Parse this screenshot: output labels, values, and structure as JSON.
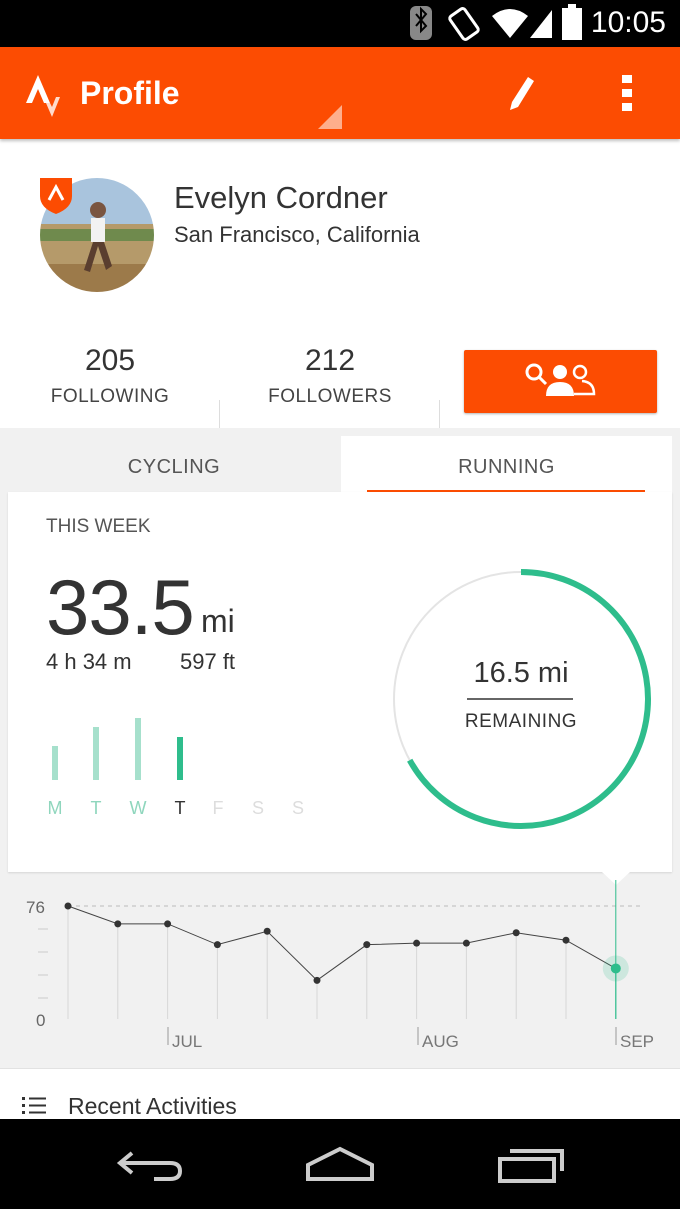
{
  "status_bar": {
    "time": "10:05",
    "icons": [
      "bluetooth-icon",
      "vibrate-icon",
      "wifi-icon",
      "signal-icon",
      "battery-icon"
    ]
  },
  "app_bar": {
    "title": "Profile",
    "logo": "strava-logo-icon",
    "edit_icon": "pencil-icon",
    "menu_icon": "overflow-menu-icon"
  },
  "profile": {
    "name": "Evelyn Cordner",
    "location": "San Francisco, California",
    "following_count": "205",
    "following_label": "FOLLOWING",
    "followers_count": "212",
    "followers_label": "FOLLOWERS",
    "find_friends_icon": "find-friends-icon"
  },
  "tabs": [
    {
      "label": "CYCLING",
      "selected": false
    },
    {
      "label": "RUNNING",
      "selected": true
    }
  ],
  "week": {
    "label": "THIS WEEK",
    "distance": "33.5",
    "distance_unit": "mi",
    "time": "4 h 34 m",
    "elevation": "597 ft",
    "remaining_value": "16.5 mi",
    "remaining_label": "REMAINING",
    "goal_progress": 0.67,
    "days": [
      "M",
      "T",
      "W",
      "T",
      "F",
      "S",
      "S"
    ],
    "day_levels": [
      0.55,
      0.85,
      1.0,
      0.7,
      0,
      0,
      0
    ]
  },
  "history": {
    "y_max_label": "76",
    "y_min_label": "0",
    "months": [
      "JUL",
      "AUG",
      "SEP"
    ],
    "weekly_values": [
      76,
      64,
      64,
      50,
      59,
      26,
      50,
      51,
      51,
      58,
      53,
      34
    ]
  },
  "recent": {
    "label": "Recent Activities",
    "icon": "list-icon"
  },
  "colors": {
    "brand": "#fc4c02",
    "accent": "#2ebd8c"
  }
}
